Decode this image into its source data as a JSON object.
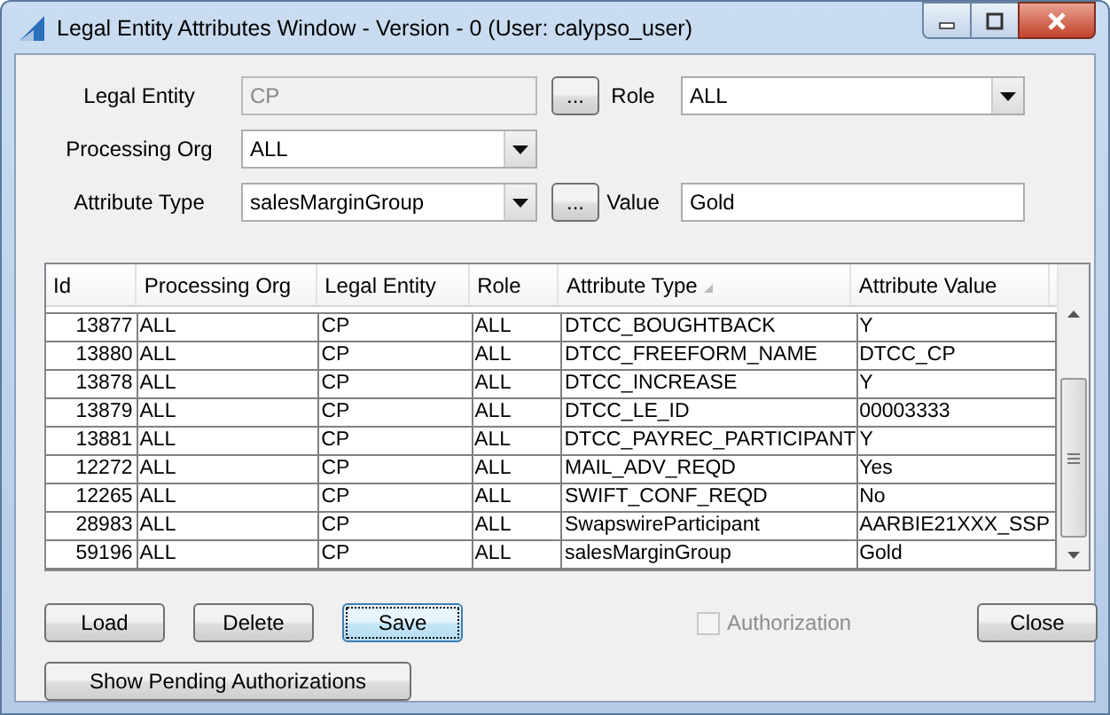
{
  "window": {
    "title": "Legal Entity Attributes Window - Version - 0 (User: calypso_user)"
  },
  "form": [
    {
      "label": "Legal Entity",
      "field": {
        "kind": "text",
        "value": "CP",
        "disabled": true
      },
      "lookup_button": "...",
      "side": {
        "label": "Role",
        "field": {
          "kind": "combo",
          "value": "ALL",
          "disabled": false
        }
      }
    },
    {
      "label": "Processing Org",
      "field": {
        "kind": "combo",
        "value": "ALL",
        "disabled": false
      }
    },
    {
      "label": "Attribute Type",
      "field": {
        "kind": "combo",
        "value": "salesMarginGroup",
        "disabled": false
      },
      "lookup_button": "...",
      "side": {
        "label": "Value",
        "field": {
          "kind": "text",
          "value": "Gold",
          "disabled": false
        }
      }
    }
  ],
  "table": {
    "columns": [
      {
        "label": "Id",
        "sorted": false
      },
      {
        "label": "Processing Org",
        "sorted": false
      },
      {
        "label": "Legal Entity",
        "sorted": false
      },
      {
        "label": "Role",
        "sorted": false
      },
      {
        "label": "Attribute Type",
        "sorted": true
      },
      {
        "label": "Attribute Value",
        "sorted": false
      }
    ],
    "rows": [
      [
        "13877",
        "ALL",
        "CP",
        "ALL",
        "DTCC_BOUGHTBACK",
        "Y"
      ],
      [
        "13880",
        "ALL",
        "CP",
        "ALL",
        "DTCC_FREEFORM_NAME",
        "DTCC_CP"
      ],
      [
        "13878",
        "ALL",
        "CP",
        "ALL",
        "DTCC_INCREASE",
        "Y"
      ],
      [
        "13879",
        "ALL",
        "CP",
        "ALL",
        "DTCC_LE_ID",
        "00003333"
      ],
      [
        "13881",
        "ALL",
        "CP",
        "ALL",
        "DTCC_PAYREC_PARTICIPANT",
        "Y"
      ],
      [
        "12272",
        "ALL",
        "CP",
        "ALL",
        "MAIL_ADV_REQD",
        "Yes"
      ],
      [
        "12265",
        "ALL",
        "CP",
        "ALL",
        "SWIFT_CONF_REQD",
        "No"
      ],
      [
        "28983",
        "ALL",
        "CP",
        "ALL",
        "SwapswireParticipant",
        "AARBIE21XXX_SSP"
      ],
      [
        "59196",
        "ALL",
        "CP",
        "ALL",
        "salesMarginGroup",
        "Gold"
      ]
    ]
  },
  "buttons": [
    {
      "label": "Load",
      "focused": false
    },
    {
      "label": "Delete",
      "focused": false
    },
    {
      "label": "Save",
      "focused": true
    }
  ],
  "authorization": {
    "label": "Authorization",
    "checked": false,
    "disabled": true
  },
  "close_button": "Close",
  "pending_button": "Show Pending Authorizations"
}
